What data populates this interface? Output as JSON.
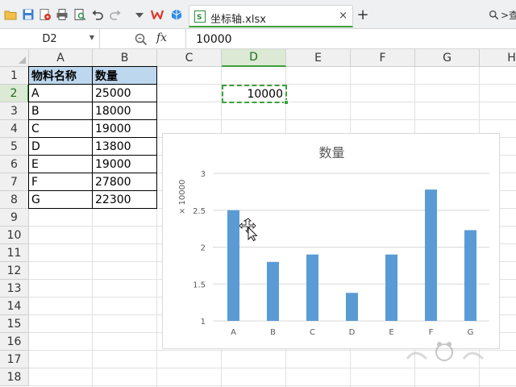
{
  "toolbar": {
    "tab_label": "坐标轴.xlsx",
    "close_label": "×",
    "new_tab_label": "+",
    "search_label": ">查",
    "icons": [
      "folder-open-icon",
      "save-icon",
      "export-pdf-icon",
      "print-icon",
      "print-preview-icon",
      "undo-icon",
      "redo-icon",
      "dropdown-icon",
      "wps-logo-icon",
      "cloud-icon",
      "excel-file-icon",
      "search-icon"
    ]
  },
  "formula_bar": {
    "name_box": "D2",
    "fx_label": "fx",
    "formula_value": "10000"
  },
  "columns": [
    "A",
    "B",
    "C",
    "D",
    "E",
    "F",
    "G",
    "H"
  ],
  "active_column": "D",
  "rows": [
    "1",
    "2",
    "3",
    "4",
    "5",
    "6",
    "7",
    "8",
    "9",
    "10",
    "11",
    "12",
    "13",
    "14",
    "15",
    "16",
    "17",
    "18"
  ],
  "active_row": "2",
  "table": {
    "headers": [
      "物料名称",
      "数量"
    ],
    "rows": [
      {
        "name": "A",
        "qty": "25000"
      },
      {
        "name": "B",
        "qty": "18000"
      },
      {
        "name": "C",
        "qty": "19000"
      },
      {
        "name": "D",
        "qty": "13800"
      },
      {
        "name": "E",
        "qty": "19000"
      },
      {
        "name": "F",
        "qty": "27800"
      },
      {
        "name": "G",
        "qty": "22300"
      }
    ]
  },
  "selected_cell": {
    "ref": "D2",
    "value": "10000"
  },
  "colors": {
    "accent_green": "#3ba03b",
    "bar_blue": "#5b9bd5",
    "header_fill": "#bdd7ee"
  },
  "chart_data": {
    "type": "bar",
    "title": "数量",
    "unit_label": "× 10000",
    "categories": [
      "A",
      "B",
      "C",
      "D",
      "E",
      "F",
      "G"
    ],
    "values": [
      2.5,
      1.8,
      1.9,
      1.38,
      1.9,
      2.78,
      2.23
    ],
    "y_ticks": [
      "1",
      "1.5",
      "2",
      "2.5",
      "3"
    ],
    "ylim": [
      1,
      3
    ],
    "grid": true,
    "legend": "none"
  }
}
